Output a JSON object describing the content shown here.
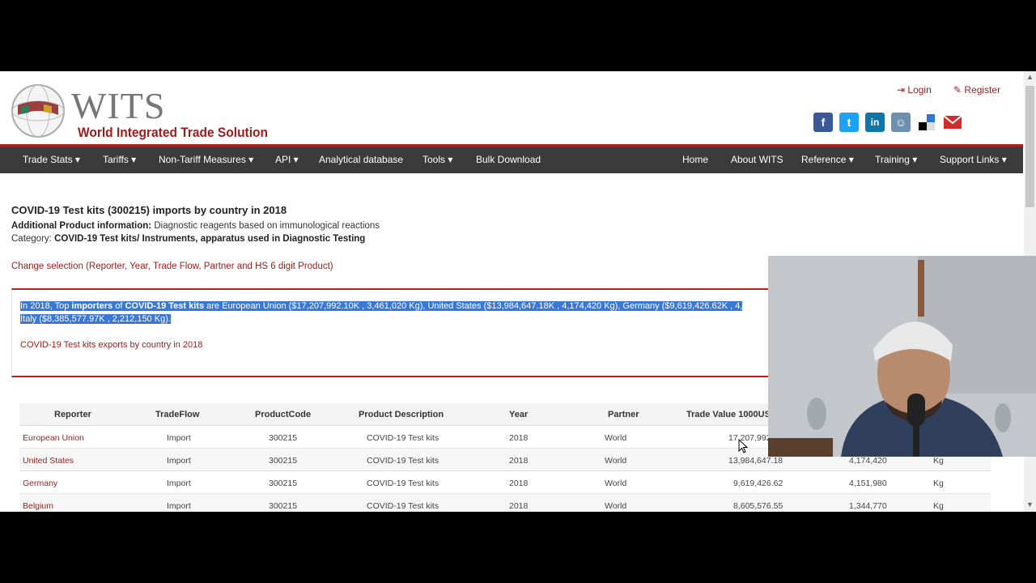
{
  "header": {
    "logo_text": "WITS",
    "logo_subtitle": "World Integrated Trade Solution",
    "login_label": "Login",
    "register_label": "Register",
    "social_icons": [
      "facebook-icon",
      "twitter-icon",
      "linkedin-icon",
      "reddit-icon",
      "delicious-icon",
      "email-icon"
    ]
  },
  "nav": {
    "left": [
      "Trade Stats ▾",
      "Tariffs ▾",
      "Non-Tariff Measures ▾",
      "API ▾",
      "Analytical database",
      "Tools ▾",
      "Bulk Download"
    ],
    "right": [
      "Home",
      "About WITS",
      "Reference ▾",
      "Training ▾",
      "Support Links ▾"
    ]
  },
  "page": {
    "title": "COVID-19 Test kits (300215) imports by country in 2018",
    "additional_label": "Additional Product information:",
    "additional_value": "Diagnostic reagents based on immunological reactions",
    "category_label": "Category:",
    "category_value": "COVID-19 Test kits/ Instruments, apparatus used in Diagnostic Testing",
    "change_selection": "Change selection (Reporter, Year, Trade Flow, Partner and HS 6 digit Product)",
    "summary_line1_a": "In 2018, Top ",
    "summary_line1_b": "importers",
    "summary_line1_c": " of ",
    "summary_line1_d": "COVID-19 Test kits",
    "summary_line1_e": " are European Union ($17,207,992.10K , 3,461,020 Kg), United States ($13,984,647.18K , 4,174,420 Kg), Germany ($9,619,426.62K , 4,",
    "summary_line2": "Italy ($8,385,577.97K , 2,212,150 Kg).",
    "exports_link": "COVID-19 Test kits exports by country in 2018"
  },
  "table": {
    "headers": [
      "Reporter",
      "TradeFlow",
      "ProductCode",
      "Product Description",
      "Year",
      "Partner",
      "Trade Value 1000USD"
    ],
    "rows": [
      {
        "reporter": "European Union",
        "flow": "Import",
        "code": "300215",
        "desc": "COVID-19 Test kits",
        "year": "2018",
        "partner": "World",
        "value": "17,207,992",
        "qty": "",
        "unit": ""
      },
      {
        "reporter": "United States",
        "flow": "Import",
        "code": "300215",
        "desc": "COVID-19 Test kits",
        "year": "2018",
        "partner": "World",
        "value": "13,984,647.18",
        "qty": "4,174,420",
        "unit": "Kg"
      },
      {
        "reporter": "Germany",
        "flow": "Import",
        "code": "300215",
        "desc": "COVID-19 Test kits",
        "year": "2018",
        "partner": "World",
        "value": "9,619,426.62",
        "qty": "4,151,980",
        "unit": "Kg"
      },
      {
        "reporter": "Belgium",
        "flow": "Import",
        "code": "300215",
        "desc": "COVID-19 Test kits",
        "year": "2018",
        "partner": "World",
        "value": "8,605,576.55",
        "qty": "1,344,770",
        "unit": "Kg"
      }
    ]
  },
  "colors": {
    "brand_red": "#9b1c1c",
    "nav_bg": "#3b3b3b",
    "selection": "#3a78d6"
  }
}
